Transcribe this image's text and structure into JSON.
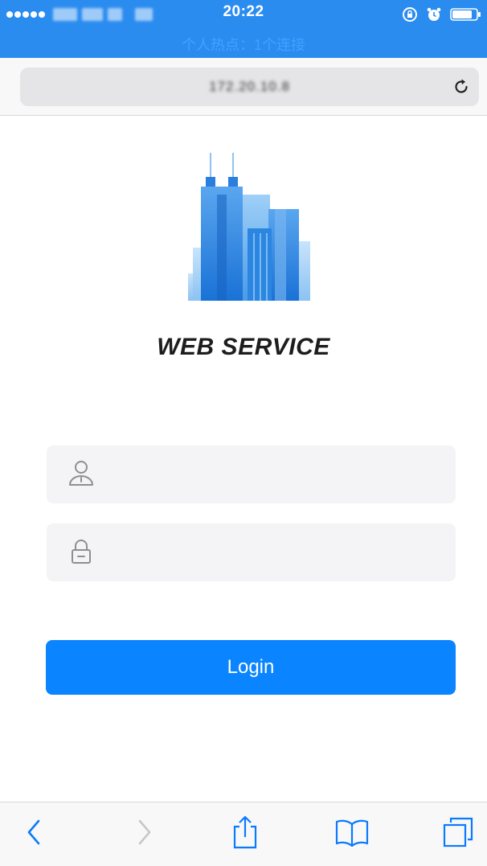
{
  "status_bar": {
    "time": "20:22",
    "hotspot": "个人热点：1个连接",
    "icons": [
      "signal-dots-icon",
      "carrier-icon",
      "orientation-lock-icon",
      "alarm-icon",
      "battery-icon"
    ]
  },
  "browser": {
    "url": "172.20.10.8",
    "reload_icon": "reload-icon"
  },
  "page": {
    "logo_icon": "buildings-logo-icon",
    "brand": "WEB SERVICE",
    "username": {
      "value": "",
      "placeholder": "",
      "icon": "user-icon"
    },
    "password": {
      "value": "",
      "placeholder": "",
      "icon": "lock-icon"
    },
    "login_label": "Login"
  },
  "toolbar": {
    "icons": [
      "back-icon",
      "forward-icon",
      "share-icon",
      "bookmarks-icon",
      "tabs-icon"
    ]
  },
  "colors": {
    "status_bar": "#2b8cf0",
    "accent": "#0a84ff",
    "field_bg": "#f4f4f6",
    "toolbar_icon": "#0a7aff",
    "toolbar_icon_disabled": "#c7c7cc"
  }
}
